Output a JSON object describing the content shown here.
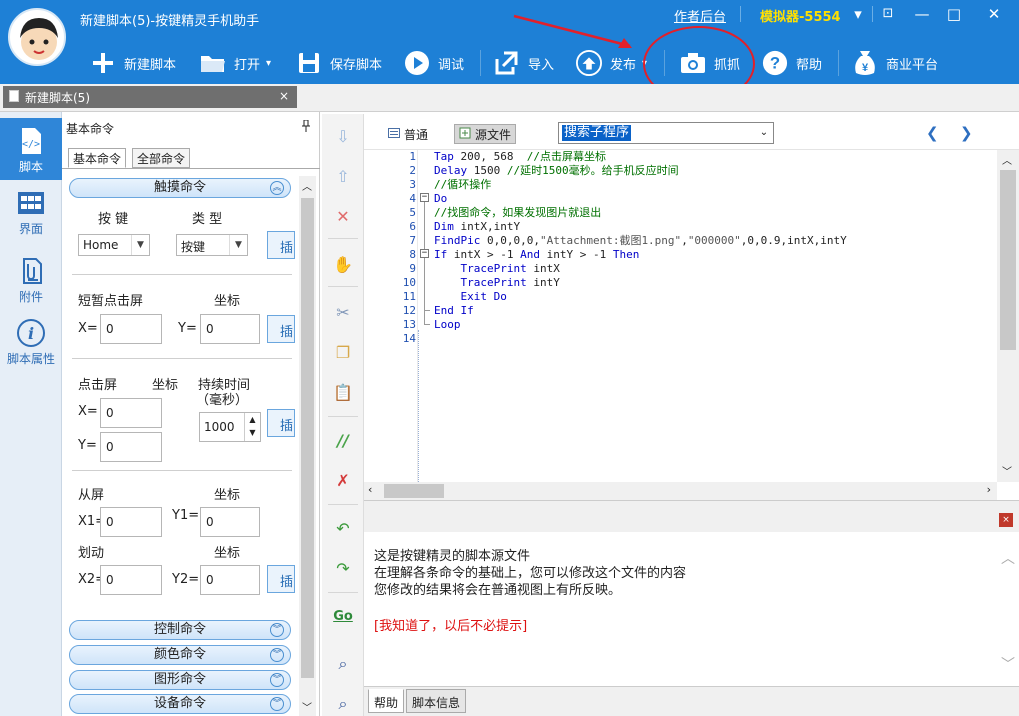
{
  "window": {
    "title": "新建脚本(5)-按键精灵手机助手",
    "author_link": "作者后台",
    "emulator": "模拟器-5554",
    "controls": {
      "menu": "▾",
      "minimize": "—",
      "maximize": "□",
      "close": "✕",
      "restore": "⊡"
    }
  },
  "toolbar": {
    "items": [
      {
        "label": "新建脚本",
        "icon": "plus-icon"
      },
      {
        "label": "打开",
        "icon": "folder-icon"
      },
      {
        "label": "保存脚本",
        "icon": "save-icon"
      },
      {
        "label": "调试",
        "icon": "play-icon"
      },
      {
        "label": "导入",
        "icon": "import-icon"
      },
      {
        "label": "发布",
        "icon": "publish-icon"
      },
      {
        "label": "抓抓",
        "icon": "camera-icon"
      },
      {
        "label": "帮助",
        "icon": "help-icon"
      },
      {
        "label": "商业平台",
        "icon": "money-bag-icon"
      }
    ],
    "dropdown_arrow": "▾"
  },
  "document_tab": {
    "label": "新建脚本(5)",
    "close": "×"
  },
  "left_nav": [
    {
      "label": "脚本",
      "icon": "script-icon",
      "active": true
    },
    {
      "label": "界面",
      "icon": "layout-grid-icon",
      "active": false
    },
    {
      "label": "附件",
      "icon": "attachment-icon",
      "active": false
    },
    {
      "label": "脚本属性",
      "icon": "info-icon",
      "active": false
    }
  ],
  "command_panel": {
    "title": "基本命令",
    "pin": "📌",
    "subtabs": [
      "基本命令",
      "全部命令"
    ],
    "groups": {
      "touch": "触摸命令",
      "control": "控制命令",
      "color": "颜色命令",
      "shape": "图形命令",
      "device": "设备命令"
    },
    "collapse_glyph": "︽",
    "expand_glyph": "︾",
    "key_section": {
      "key_label": "按 键",
      "type_label": "类 型",
      "key_value": "Home",
      "type_value": "按键"
    },
    "tap_section": {
      "title": "短暂点击屏",
      "coord_label": "坐标",
      "x_label": "X=",
      "y_label": "Y=",
      "x_value": "0",
      "y_value": "0"
    },
    "press_section": {
      "title": "点击屏",
      "coord_label": "坐标",
      "duration_label": "持续时间",
      "duration_unit": "（毫秒）",
      "x_label": "X=",
      "y_label": "Y=",
      "x_value": "0",
      "y_value": "0",
      "duration_value": "1000"
    },
    "swipe_section": {
      "from_label": "从屏",
      "swipe_label": "划动",
      "coord_label": "坐标",
      "x1_label": "X1=",
      "y1_label": "Y1=",
      "x2_label": "X2=",
      "y2_label": "Y2=",
      "x1_value": "0",
      "y1_value": "0",
      "x2_value": "0",
      "y2_value": "0"
    },
    "insert_button": "插"
  },
  "editor": {
    "mode_normal": "普通",
    "mode_source": "源文件",
    "search_placeholder": "搜索子程序",
    "lines": [
      "Tap 200, 568  //点击屏幕坐标",
      "Delay 1500 //延时1500毫秒。给手机反应时间",
      "//循环操作",
      "Do",
      "//找图命令，如果发现图片就退出",
      "Dim intX,intY",
      "FindPic 0,0,0,0,\"Attachment:截图1.png\",\"000000\",0,0.9,intX,intY",
      "If intX > -1 And intY > -1 Then",
      "    TracePrint intX",
      "    TracePrint intY",
      "    Exit Do",
      "End If",
      "Loop",
      ""
    ]
  },
  "help": {
    "line1": "这是按键精灵的脚本源文件",
    "line2": "在理解各条命令的基础上，您可以修改这个文件的内容",
    "line3": "您修改的结果将会在普通视图上有所反映。",
    "dismiss": "[我知道了，以后不必提示]",
    "close": "×",
    "tabs": [
      "帮助",
      "脚本信息"
    ]
  },
  "colors": {
    "titlebar": "#1e80d6",
    "annotation": "#e2202a",
    "keyword": "#0000c8",
    "comment": "#007000"
  }
}
